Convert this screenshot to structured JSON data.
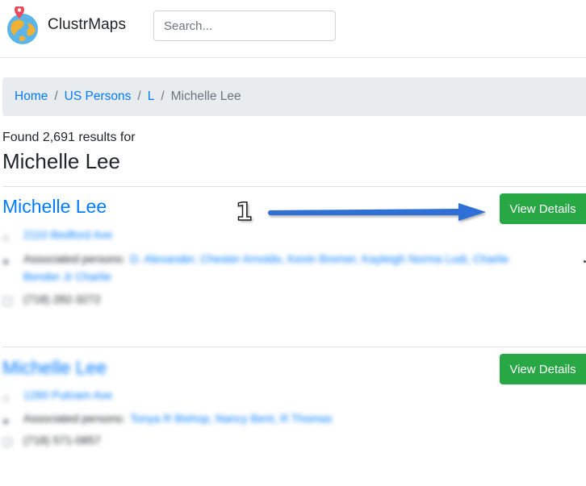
{
  "header": {
    "brand": "ClustrMaps",
    "search_placeholder": "Search...",
    "logo_icon": "globe-pin-logo"
  },
  "breadcrumb": {
    "items": [
      "Home",
      "US Persons",
      "L"
    ],
    "active": "Michelle Lee"
  },
  "results_summary": {
    "prefix": "Found",
    "count": "2,691",
    "suffix": "results for",
    "query": "Michelle Lee"
  },
  "results": [
    {
      "name": "Michelle Lee",
      "button_label": "View Details",
      "address": "2110 Bedford Ave",
      "associated_label": "Associated persons:",
      "associated_persons": "D. Alexander, Chester Arnoldo, Kevin Bremer, Kayleigh Norma Lodi, Charlie",
      "associated_persons_cont": "Bender Jr Charlie",
      "phone": "(718) 282-3272"
    },
    {
      "name": "Michelle Lee",
      "button_label": "View Details",
      "address": "1260 Putnam Ave",
      "associated_label": "Associated persons:",
      "associated_persons": "Tonya R Bishop, Nancy Bent, R Thomas",
      "phone": "(718) 571-0857"
    }
  ],
  "annotation": {
    "number": "1",
    "arrow_color": "#2f6fd6"
  },
  "colors": {
    "link": "#007bff",
    "button": "#28a745",
    "breadcrumb_bg": "#e9ecef"
  }
}
